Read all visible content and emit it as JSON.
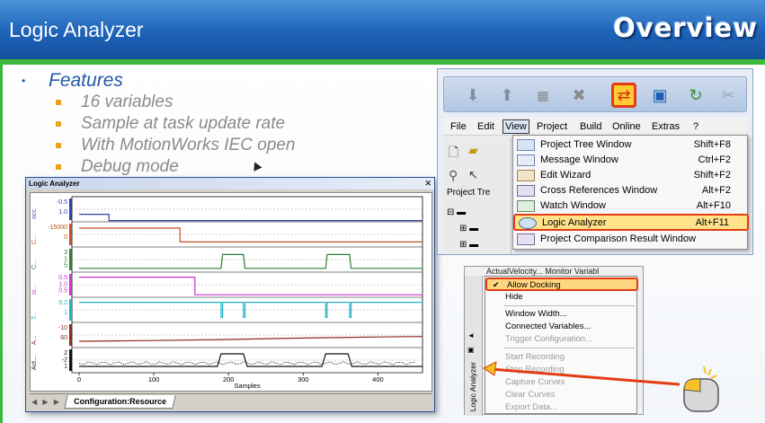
{
  "header": {
    "title": "Logic Analyzer",
    "overview": "Overview"
  },
  "features": {
    "heading": "Features",
    "items": [
      "16 variables",
      "Sample at task update rate",
      "With MotionWorks IEC open",
      "Debug mode"
    ]
  },
  "analyzer_window": {
    "title": "Logic Analyzer",
    "x_axis_label": "Samples",
    "x_ticks": [
      "0",
      "100",
      "200",
      "300",
      "400"
    ],
    "channels": [
      {
        "name": "occ.",
        "ticks": [
          "-0.5",
          "1.0"
        ],
        "color": "#2b3fae"
      },
      {
        "name": "C...",
        "ticks": [
          "-15000",
          "0"
        ],
        "color": "#c0501c"
      },
      {
        "name": "C...",
        "ticks": [
          "3",
          "1",
          "5"
        ],
        "color": "#2e7d32"
      },
      {
        "name": "Is...",
        "ticks": [
          "0.5",
          "1.0",
          "0.5"
        ],
        "color": "#cc33cc"
      },
      {
        "name": "T...",
        "ticks": [
          "0.2",
          "1"
        ],
        "color": "#22b0c8"
      },
      {
        "name": "A...",
        "ticks": [
          "-10",
          "60"
        ],
        "color": "#8b2b1a"
      },
      {
        "name": "Act...",
        "ticks": [
          "2",
          "-2",
          "1"
        ],
        "color": "#111111"
      }
    ],
    "tab": "Configuration:Resource"
  },
  "menubar": [
    "File",
    "Edit",
    "View",
    "Project",
    "Build",
    "Online",
    "Extras",
    "?"
  ],
  "tree_label": "Project Tre",
  "view_menu": [
    {
      "label": "Project Tree Window",
      "shortcut": "Shift+F8"
    },
    {
      "label": "Message Window",
      "shortcut": "Ctrl+F2"
    },
    {
      "label": "Edit Wizard",
      "shortcut": "Shift+F2"
    },
    {
      "label": "Cross References Window",
      "shortcut": "Alt+F2"
    },
    {
      "label": "Watch Window",
      "shortcut": "Alt+F10"
    },
    {
      "label": "Logic Analyzer",
      "shortcut": "Alt+F11"
    },
    {
      "label": "Project Comparison Result Window",
      "shortcut": ""
    }
  ],
  "context_menu": {
    "top_row": "ActualVelocity...   Monitor Variabl",
    "side_label": "Logic Analyzer",
    "items": [
      {
        "label": "Allow Docking",
        "disabled": false
      },
      {
        "label": "Hide",
        "disabled": false
      },
      {
        "label": "Window Width...",
        "disabled": false
      },
      {
        "label": "Connected Variables...",
        "disabled": false
      },
      {
        "label": "Trigger Configuration...",
        "disabled": true
      },
      {
        "label": "Start Recording",
        "disabled": true
      },
      {
        "label": "Stop Recording",
        "disabled": true
      },
      {
        "label": "Capture Curves",
        "disabled": true
      },
      {
        "label": "Clear Curves",
        "disabled": true
      },
      {
        "label": "Export Data...",
        "disabled": true
      }
    ]
  },
  "colors": {
    "header_blue": "#1e63b8",
    "accent_green": "#3cb83c",
    "highlight_red": "#e43b12",
    "bullet_orange": "#e8a317"
  }
}
